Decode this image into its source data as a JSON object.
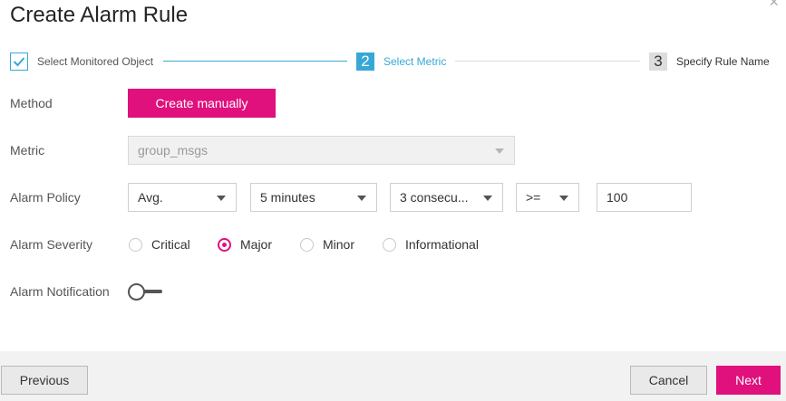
{
  "dialog": {
    "title": "Create Alarm Rule",
    "close_glyph": "×"
  },
  "steps": [
    {
      "number": "",
      "label": "Select Monitored Object",
      "state": "done"
    },
    {
      "number": "2",
      "label": "Select Metric",
      "state": "active"
    },
    {
      "number": "3",
      "label": "Specify Rule Name",
      "state": "pending"
    }
  ],
  "form": {
    "method": {
      "label": "Method",
      "button_label": "Create manually"
    },
    "metric": {
      "label": "Metric",
      "value": "group_msgs"
    },
    "alarm_policy": {
      "label": "Alarm Policy",
      "statistic": "Avg.",
      "period": "5 minutes",
      "consecutive": "3 consecu...",
      "operator": ">=",
      "threshold": "100"
    },
    "severity": {
      "label": "Alarm Severity",
      "options": [
        "Critical",
        "Major",
        "Minor",
        "Informational"
      ],
      "selected": "Major"
    },
    "notification": {
      "label": "Alarm Notification",
      "enabled": false
    }
  },
  "footer": {
    "previous_label": "Previous",
    "cancel_label": "Cancel",
    "next_label": "Next"
  },
  "colors": {
    "accent": "#e0107c",
    "step_active": "#37a8d6",
    "footer_bg": "#f2f2f2"
  }
}
